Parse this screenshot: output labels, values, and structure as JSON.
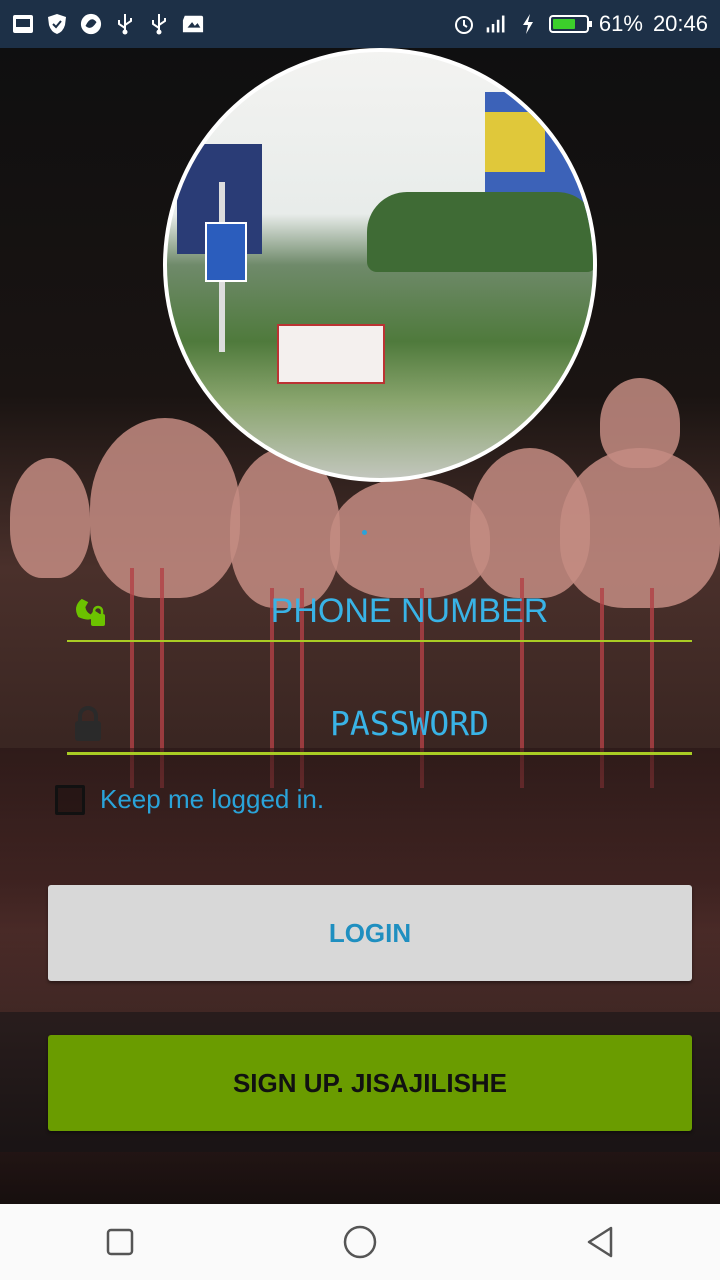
{
  "status_bar": {
    "battery_percent": "61%",
    "time": "20:46",
    "colors": {
      "background": "#1d3047",
      "battery_fill": "#3ccf2b"
    },
    "icons_left": [
      "gallery-icon",
      "shield-icon",
      "swirl-app-icon",
      "usb-icon",
      "usb-icon",
      "sd-card-icon"
    ],
    "icons_right": [
      "alarm-icon",
      "signal-icon",
      "charging-icon",
      "battery-icon"
    ]
  },
  "login_form": {
    "phone_placeholder": "PHONE NUMBER",
    "password_placeholder": "PASSWORD",
    "keep_logged_in_label": "Keep me logged in.",
    "keep_logged_in_checked": false,
    "login_button": "LOGIN",
    "signup_button": "SIGN UP. JISAJILISHE",
    "colors": {
      "accent": "#a9cc24",
      "input_text": "#39b3e6",
      "login_text": "#1f8fc0",
      "signup_bg": "#6a9c00"
    }
  },
  "nav_bar": {
    "buttons": [
      "recent-apps-icon",
      "home-icon",
      "back-icon"
    ]
  }
}
